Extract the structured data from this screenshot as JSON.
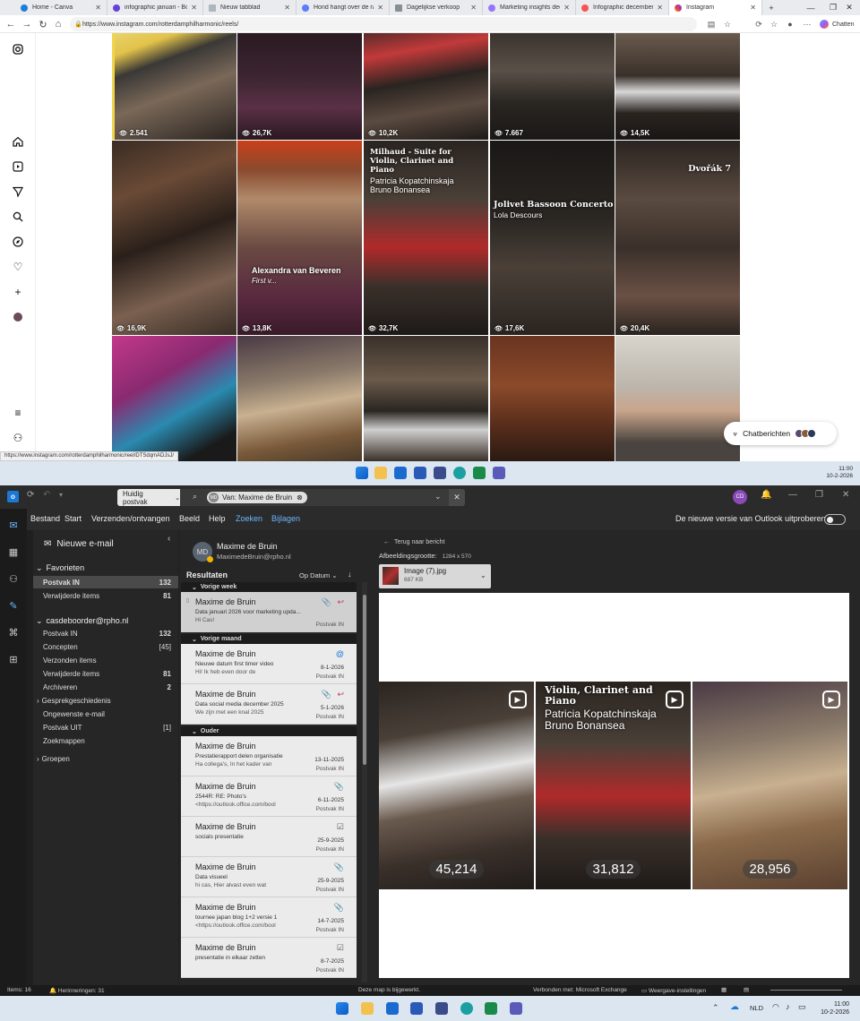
{
  "browser": {
    "tabs": [
      {
        "label": "Home - Canva",
        "color": "#1c7ed6"
      },
      {
        "label": "infographic januari - Boekje",
        "color": "#6741d9"
      },
      {
        "label": "Nieuw tabblad",
        "color": "#868e96"
      },
      {
        "label": "Hond hangt over de rand o",
        "color": "#5c7cfa"
      },
      {
        "label": "Dagelijkse verkoop",
        "color": "#868e96"
      },
      {
        "label": "Marketing insights decemb",
        "color": "#9775fa"
      },
      {
        "label": "Infographic december by R",
        "color": "#fa5252"
      },
      {
        "label": "Instagram",
        "color": "#d6336c"
      }
    ],
    "url": "https://www.instagram.com/rotterdamphilharmonic/reels/",
    "chat_label": "Chatten",
    "status_url": "https://www.instagram.com/rotterdamphilharmonic/reel/DTSdqmADJsJ/"
  },
  "instagram": {
    "views_row1": [
      "2.541",
      "26,7K",
      "10,2K",
      "7.667",
      "14,5K"
    ],
    "views_row2": [
      "16,9K",
      "13,8K",
      "32,7K",
      "17,6K",
      "20,4K"
    ],
    "tile_milhaud_title": "Milhaud - Suite for Violin, Clarinet and Piano",
    "tile_milhaud_sub": "Patricia Kopatchinskaja Bruno Bonansea",
    "tile_jolivet_title": "Jolivet Bassoon Concerto",
    "tile_jolivet_sub": "Lola Descours",
    "tile_dvorak_title": "Dvořák 7",
    "tile_alex_name": "Alexandra van Beveren",
    "tile_alex_sub": "First v...",
    "chat_messages": "Chatberichten"
  },
  "taskbar_top": {
    "time": "11:00",
    "date": "10-2-2026"
  },
  "outlook": {
    "search_scope": "Huidig postvak",
    "search_chip_initials": "MD",
    "search_chip": "Van: Maxime de Bruin",
    "avatar_initials": "CD",
    "menu": [
      "Bestand",
      "Start",
      "Verzenden/ontvangen",
      "Beeld",
      "Help",
      "Zoeken",
      "Bijlagen"
    ],
    "try_new": "De nieuwe versie van Outlook uitproberen",
    "new_mail": "Nieuwe e-mail",
    "favorites_label": "Favorieten",
    "favorites": [
      {
        "label": "Postvak IN",
        "count": "132"
      },
      {
        "label": "Verwijderde items",
        "count": "81"
      }
    ],
    "account": "casdeboorder@rpho.nl",
    "folders": [
      {
        "label": "Postvak IN",
        "count": "132"
      },
      {
        "label": "Concepten",
        "count": "[45]"
      },
      {
        "label": "Verzonden items",
        "count": ""
      },
      {
        "label": "Verwijderde items",
        "count": "81"
      },
      {
        "label": "Archiveren",
        "count": "2"
      },
      {
        "label": "Gesprekgeschiedenis",
        "count": ""
      },
      {
        "label": "Ongewenste e-mail",
        "count": ""
      },
      {
        "label": "Postvak UIT",
        "count": "[1]"
      },
      {
        "label": "Zoekmappen",
        "count": ""
      }
    ],
    "groups_label": "Groepen",
    "contact_initials": "MD",
    "contact_name": "Maxime de Bruin",
    "contact_email": "MaximedeBruin@rpho.nl",
    "results_label": "Resultaten",
    "sort_label": "Op Datum",
    "groups": [
      "Vorige week",
      "Vorige maand",
      "Ouder"
    ],
    "messages": [
      {
        "from": "Maxime de Bruin",
        "subject": "Data januari 2026 voor marketing upda...",
        "preview": "Hi Cas!",
        "date": "",
        "folder": "Postvak IN",
        "icon": "📎 ↩"
      },
      {
        "from": "Maxime de Bruin",
        "subject": "Nieuwe datum first timer video",
        "preview": "Hi!  Ik heb even door de",
        "date": "8-1-2026",
        "folder": "Postvak IN",
        "icon": "@"
      },
      {
        "from": "Maxime de Bruin",
        "subject": "Data social media december 2025",
        "preview": "We zijn met een knal 2025",
        "date": "5-1-2026",
        "folder": "Postvak IN",
        "icon": "📎 ↩"
      },
      {
        "from": "Maxime de Bruin",
        "subject": "Prestatierapport delen organisatie",
        "preview": "Ha collega's,   In het kader van",
        "date": "13-11-2025",
        "folder": "Postvak IN",
        "icon": ""
      },
      {
        "from": "Maxime de Bruin",
        "subject": "2544R: RE: Photo's",
        "preview": "<https://outlook.office.com/bool",
        "date": "6-11-2025",
        "folder": "Postvak IN",
        "icon": "📎"
      },
      {
        "from": "Maxime de Bruin",
        "subject": "socials presentatie",
        "preview": "",
        "date": "25-9-2025",
        "folder": "Postvak IN",
        "icon": "☑"
      },
      {
        "from": "Maxime de Bruin",
        "subject": "Data visueel",
        "preview": "hi cas,   Hier alvast even wat",
        "date": "25-9-2025",
        "folder": "Postvak IN",
        "icon": "📎"
      },
      {
        "from": "Maxime de Bruin",
        "subject": "tournee japan blog 1+2 versie 1",
        "preview": "<https://outlook.office.com/bool",
        "date": "14-7-2025",
        "folder": "Postvak IN",
        "icon": "📎"
      },
      {
        "from": "Maxime de Bruin",
        "subject": "presentatie in elkaar zetten",
        "preview": "",
        "date": "8-7-2025",
        "folder": "Postvak IN",
        "icon": "☑"
      }
    ],
    "back_label": "Terug naar bericht",
    "image_size_label": "Afbeeldingsgrootte:",
    "image_size_value": "1284 x 570",
    "attachment_name": "Image (7).jpg",
    "attachment_size": "687 KB",
    "image_tiles": [
      {
        "views": "45,214"
      },
      {
        "views": "31,812",
        "title": "Violin, Clarinet and Piano",
        "subtitle": "Patricia Kopatchinskaja Bruno Bonansea"
      },
      {
        "views": "28,956"
      }
    ],
    "status_items": "Items: 16",
    "status_reminders": "Herinneringen: 31",
    "status_folder": "Deze map is bijgewerkt.",
    "status_connected": "Verbonden met: Microsoft Exchange",
    "status_display": "Weergave-instellingen"
  },
  "taskbar_bottom": {
    "lang": "NLD",
    "time": "11:00",
    "date": "10-2-2026"
  }
}
